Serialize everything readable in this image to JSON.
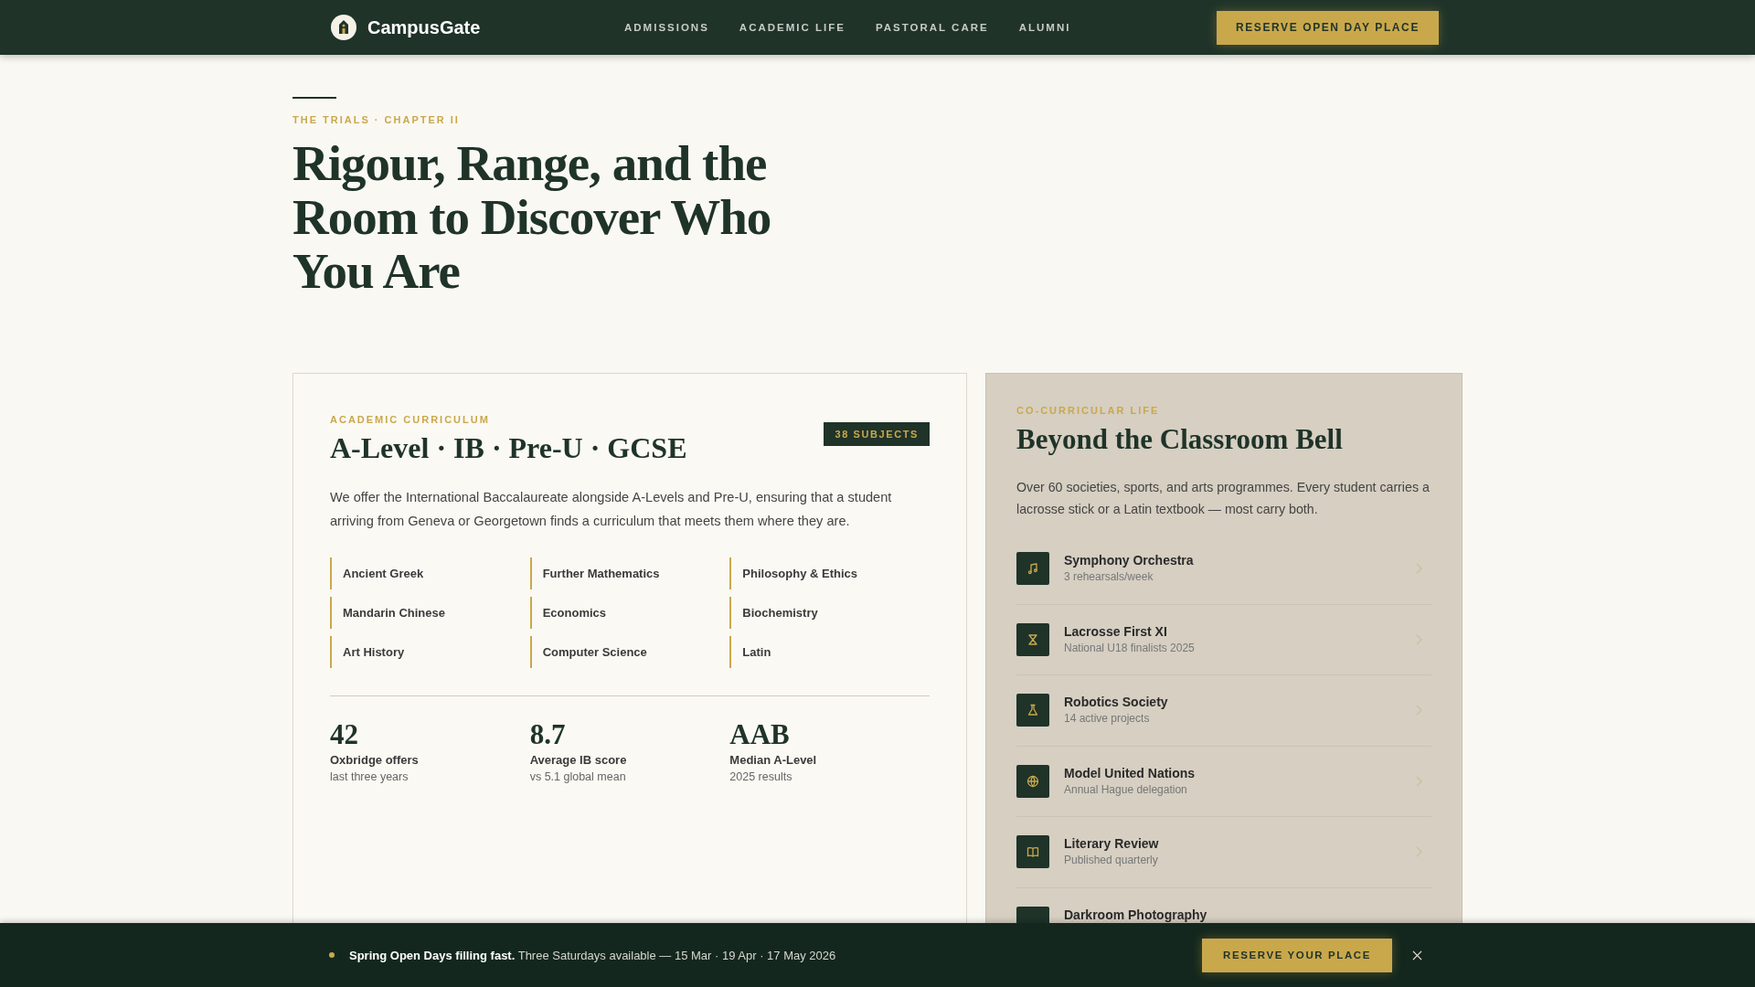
{
  "header": {
    "brand": "CampusGate",
    "nav": [
      {
        "label": "ADMISSIONS"
      },
      {
        "label": "ACADEMIC LIFE"
      },
      {
        "label": "PASTORAL CARE"
      },
      {
        "label": "ALUMNI"
      }
    ],
    "cta": "RESERVE OPEN DAY PLACE"
  },
  "hero": {
    "eyebrow": "THE TRIALS · CHAPTER II",
    "title": "Rigour, Range, and the Room to Discover Who You Are"
  },
  "curriculum": {
    "eyebrow": "ACADEMIC CURRICULUM",
    "badge": "38 SUBJECTS",
    "title": "A-Level · IB · Pre-U · GCSE",
    "text": "We offer the International Baccalaureate alongside A-Levels and Pre-U, ensuring that a student arriving from Geneva or Georgetown finds a curriculum that meets them where they are.",
    "subjects": [
      "Ancient Greek",
      "Further Mathematics",
      "Philosophy & Ethics",
      "Mandarin Chinese",
      "Economics",
      "Biochemistry",
      "Art History",
      "Computer Science",
      "Latin"
    ],
    "stats": [
      {
        "value": "42",
        "label": "Oxbridge offers",
        "note": "last three years"
      },
      {
        "value": "8.7",
        "label": "Average IB score",
        "note": "vs 5.1 global mean"
      },
      {
        "value": "AAB",
        "label": "Median A-Level",
        "note": "2025 results"
      }
    ]
  },
  "cocurricular": {
    "eyebrow": "CO-CURRICULAR LIFE",
    "title": "Beyond the Classroom Bell",
    "text": "Over 60 societies, sports, and arts programmes. Every student carries a lacrosse stick or a Latin textbook — most carry both.",
    "items": [
      {
        "name": "Symphony Orchestra",
        "note": "3 rehearsals/week"
      },
      {
        "name": "Lacrosse First XI",
        "note": "National U18 finalists 2025"
      },
      {
        "name": "Robotics Society",
        "note": "14 active projects"
      },
      {
        "name": "Model United Nations",
        "note": "Annual Hague delegation"
      },
      {
        "name": "Literary Review",
        "note": "Published quarterly"
      },
      {
        "name": "Darkroom Photography"
      }
    ]
  },
  "banner": {
    "lead": "Spring Open Days filling fast.",
    "text": "Three Saturdays available — 15 Mar · 19 Apr · 17 May 2026",
    "button": "RESERVE YOUR PLACE"
  }
}
